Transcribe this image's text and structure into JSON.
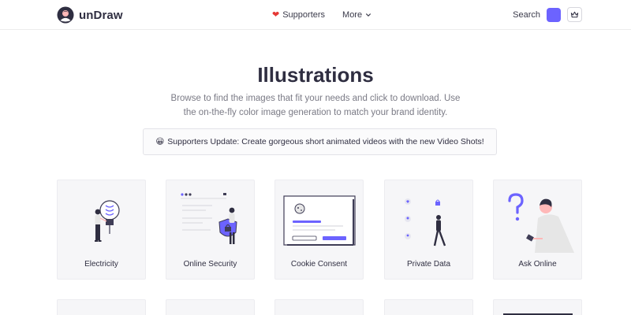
{
  "brand": {
    "name": "unDraw"
  },
  "nav": {
    "supporters_label": "Supporters",
    "more_label": "More"
  },
  "tools": {
    "search_label": "Search",
    "accent_color": "#6c63ff"
  },
  "hero": {
    "title": "Illustrations",
    "subtitle": "Browse to find the images that fit your needs and click to download. Use the on-the-fly color image generation to match your brand identity."
  },
  "banner": {
    "emoji": "😀",
    "text": "Supporters Update: Create gorgeous short animated videos with the new Video Shots!"
  },
  "cards": [
    {
      "label": "Electricity",
      "icon": "electricity-illustration"
    },
    {
      "label": "Online Security",
      "icon": "online-security-illustration"
    },
    {
      "label": "Cookie Consent",
      "icon": "cookie-consent-illustration"
    },
    {
      "label": "Private Data",
      "icon": "private-data-illustration"
    },
    {
      "label": "Ask Online",
      "icon": "ask-online-illustration"
    }
  ]
}
